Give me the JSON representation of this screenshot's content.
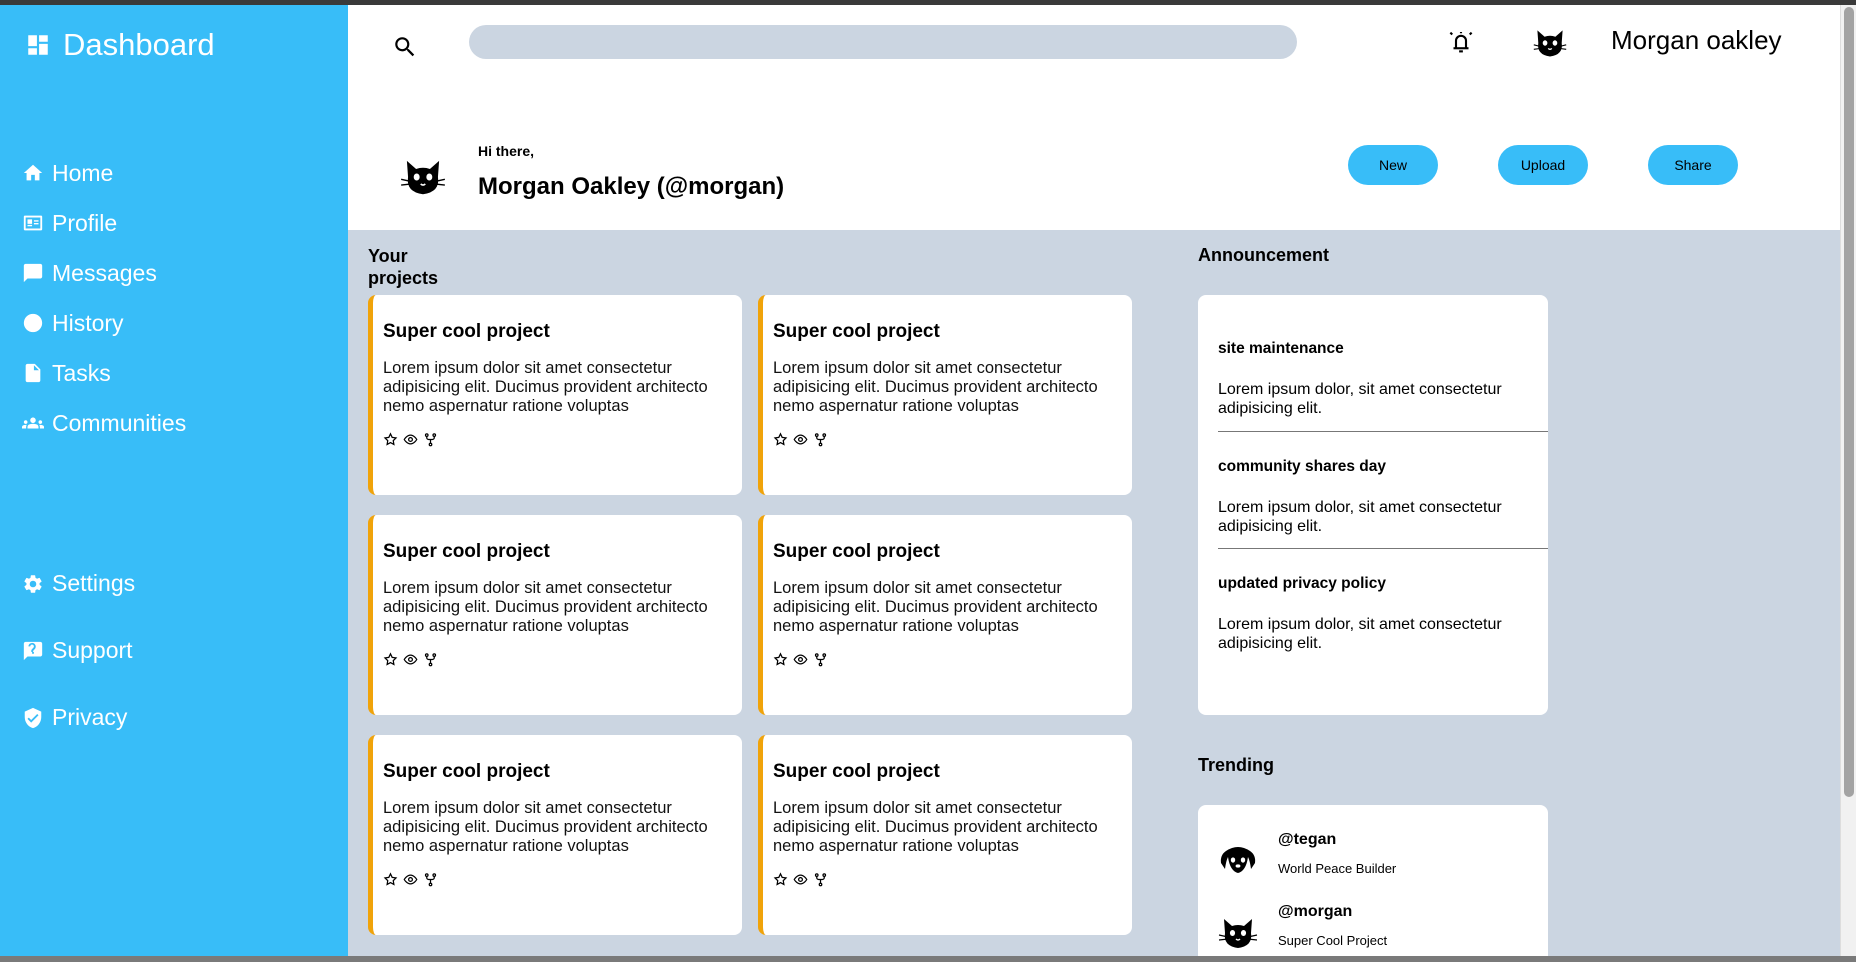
{
  "sidebar": {
    "brand": "Dashboard",
    "items": [
      {
        "label": "Home",
        "icon": "home-icon"
      },
      {
        "label": "Profile",
        "icon": "id-card-icon"
      },
      {
        "label": "Messages",
        "icon": "chat-icon"
      },
      {
        "label": "History",
        "icon": "clock-icon"
      },
      {
        "label": "Tasks",
        "icon": "document-icon"
      },
      {
        "label": "Communities",
        "icon": "people-icon"
      }
    ],
    "bottom_items": [
      {
        "label": "Settings",
        "icon": "gear-icon"
      },
      {
        "label": "Support",
        "icon": "help-bubble-icon"
      },
      {
        "label": "Privacy",
        "icon": "shield-icon"
      }
    ]
  },
  "topbar": {
    "search_placeholder": "",
    "user_name": "Morgan oakley"
  },
  "greeting": {
    "hi": "Hi there,",
    "name": "Morgan Oakley (@morgan)",
    "buttons": [
      "New",
      "Upload",
      "Share"
    ]
  },
  "projects": {
    "title_line1": "Your",
    "title_line2": "projects",
    "cards": [
      {
        "title": "Super cool project",
        "desc": "Lorem ipsum dolor sit amet consectetur adipisicing elit. Ducimus provident architecto nemo aspernatur ratione voluptas"
      },
      {
        "title": "Super cool project",
        "desc": "Lorem ipsum dolor sit amet consectetur adipisicing elit. Ducimus provident architecto nemo aspernatur ratione voluptas"
      },
      {
        "title": "Super cool project",
        "desc": "Lorem ipsum dolor sit amet consectetur adipisicing elit. Ducimus provident architecto nemo aspernatur ratione voluptas"
      },
      {
        "title": "Super cool project",
        "desc": "Lorem ipsum dolor sit amet consectetur adipisicing elit. Ducimus provident architecto nemo aspernatur ratione voluptas"
      },
      {
        "title": "Super cool project",
        "desc": "Lorem ipsum dolor sit amet consectetur adipisicing elit. Ducimus provident architecto nemo aspernatur ratione voluptas"
      },
      {
        "title": "Super cool project",
        "desc": "Lorem ipsum dolor sit amet consectetur adipisicing elit. Ducimus provident architecto nemo aspernatur ratione voluptas"
      }
    ]
  },
  "announcement": {
    "title": "Announcement",
    "items": [
      {
        "title": "site maintenance",
        "body": "Lorem ipsum dolor, sit amet consectetur adipisicing elit."
      },
      {
        "title": "community shares day",
        "body": "Lorem ipsum dolor, sit amet consectetur adipisicing elit."
      },
      {
        "title": "updated privacy policy",
        "body": "Lorem ipsum dolor, sit amet consectetur adipisicing elit."
      }
    ]
  },
  "trending": {
    "title": "Trending",
    "items": [
      {
        "handle": "@tegan",
        "subtitle": "World Peace Builder",
        "avatar": "dog-icon"
      },
      {
        "handle": "@morgan",
        "subtitle": "Super Cool Project",
        "avatar": "cat-icon"
      }
    ]
  },
  "colors": {
    "accent": "#38bdf8",
    "background": "#cbd5e1",
    "card_border": "#f0a30a"
  }
}
